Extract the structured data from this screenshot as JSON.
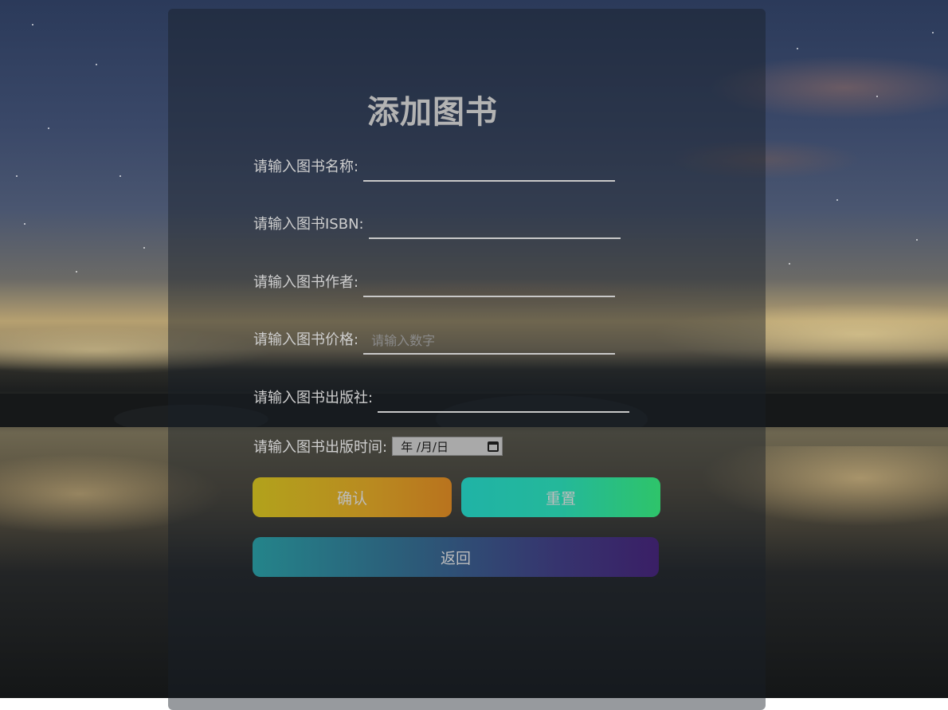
{
  "form": {
    "title": "添加图书",
    "fields": [
      {
        "label": "请输入图书名称:",
        "value": "",
        "placeholder": ""
      },
      {
        "label": "请输入图书ISBN:",
        "value": "",
        "placeholder": ""
      },
      {
        "label": "请输入图书作者:",
        "value": "",
        "placeholder": ""
      },
      {
        "label": "请输入图书价格:",
        "value": "",
        "placeholder": "请输入数字"
      },
      {
        "label": "请输入图书出版社:",
        "value": "",
        "placeholder": ""
      }
    ],
    "date_field": {
      "label": "请输入图书出版时间:",
      "display": "年 /月/日",
      "icon": "calendar-icon"
    },
    "buttons": {
      "confirm": "确认",
      "reset": "重置",
      "back": "返回"
    }
  },
  "colors": {
    "confirm_gradient": [
      "#b2a21c",
      "#b9731e"
    ],
    "reset_gradient": [
      "#20b3a6",
      "#2ec46a"
    ],
    "back_gradient": [
      "#24848a",
      "#3a1f66"
    ]
  }
}
